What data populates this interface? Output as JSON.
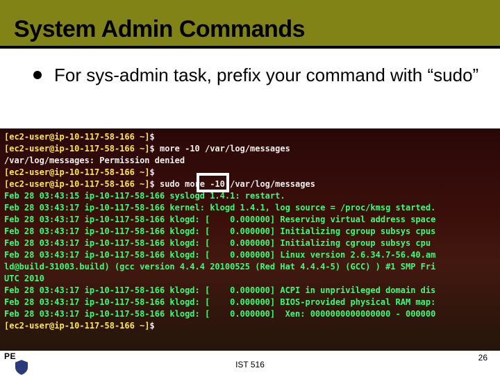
{
  "slide": {
    "title": "System Admin Commands",
    "bullet": "For sys-admin task, prefix your command with “sudo”"
  },
  "terminal": {
    "lines": [
      {
        "segs": [
          {
            "c": "yellow",
            "t": "[ec2-user@ip-10-117-58-166 ~]"
          },
          {
            "c": "white",
            "t": "$"
          }
        ]
      },
      {
        "segs": [
          {
            "c": "yellow",
            "t": "[ec2-user@ip-10-117-58-166 ~]"
          },
          {
            "c": "white",
            "t": "$ more -10 /var/log/messages"
          }
        ]
      },
      {
        "segs": [
          {
            "c": "white",
            "t": "/var/log/messages: Permission denied"
          }
        ]
      },
      {
        "segs": [
          {
            "c": "yellow",
            "t": "[ec2-user@ip-10-117-58-166 ~]"
          },
          {
            "c": "white",
            "t": "$"
          }
        ]
      },
      {
        "segs": [
          {
            "c": "yellow",
            "t": "[ec2-user@ip-10-117-58-166 ~]"
          },
          {
            "c": "white",
            "t": "$ sudo more -10 /var/log/messages"
          }
        ]
      },
      {
        "segs": [
          {
            "c": "green",
            "t": "Feb 28 03:43:15 ip-10-117-58-166 syslogd 1.4.1: restart."
          }
        ]
      },
      {
        "segs": [
          {
            "c": "green",
            "t": "Feb 28 03:43:17 ip-10-117-58-166 kernel: klogd 1.4.1, log source = /proc/kmsg started."
          }
        ]
      },
      {
        "segs": [
          {
            "c": "green",
            "t": "Feb 28 03:43:17 ip-10-117-58-166 klogd: [    0.000000] Reserving virtual address space"
          }
        ]
      },
      {
        "segs": [
          {
            "c": "green",
            "t": "Feb 28 03:43:17 ip-10-117-58-166 klogd: [    0.000000] Initializing cgroup subsys cpus"
          }
        ]
      },
      {
        "segs": [
          {
            "c": "green",
            "t": "Feb 28 03:43:17 ip-10-117-58-166 klogd: [    0.000000] Initializing cgroup subsys cpu"
          }
        ]
      },
      {
        "segs": [
          {
            "c": "green",
            "t": "Feb 28 03:43:17 ip-10-117-58-166 klogd: [    0.000000] Linux version 2.6.34.7-56.40.am"
          }
        ]
      },
      {
        "segs": [
          {
            "c": "green",
            "t": "ld@build-31003.build) (gcc version 4.4.4 20100525 (Red Hat 4.4.4-5) (GCC) ) #1 SMP Fri"
          }
        ]
      },
      {
        "segs": [
          {
            "c": "green",
            "t": "UTC 2010"
          }
        ]
      },
      {
        "segs": [
          {
            "c": "green",
            "t": "Feb 28 03:43:17 ip-10-117-58-166 klogd: [    0.000000] ACPI in unprivileged domain dis"
          }
        ]
      },
      {
        "segs": [
          {
            "c": "green",
            "t": "Feb 28 03:43:17 ip-10-117-58-166 klogd: [    0.000000] BIOS-provided physical RAM map:"
          }
        ]
      },
      {
        "segs": [
          {
            "c": "green",
            "t": "Feb 28 03:43:17 ip-10-117-58-166 klogd: [    0.000000]  Xen: 0000000000000000 - 000000"
          }
        ]
      },
      {
        "segs": [
          {
            "c": "yellow",
            "t": "[ec2-user@ip-10-117-58-166 ~]"
          },
          {
            "c": "white",
            "t": "$"
          }
        ]
      }
    ]
  },
  "footer": {
    "left": "PE",
    "center": "IST 516",
    "right": "26"
  }
}
